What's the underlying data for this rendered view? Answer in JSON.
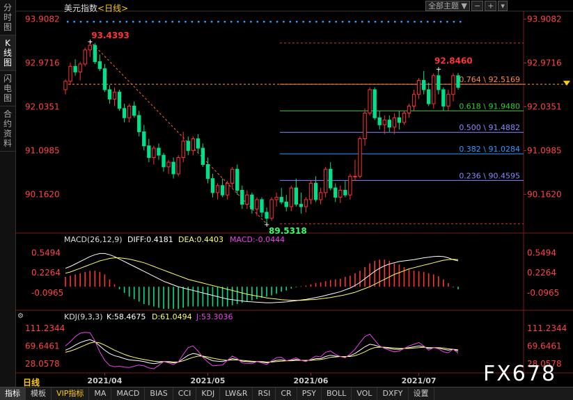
{
  "sidebar": [
    {
      "label": "分时图",
      "active": false
    },
    {
      "label": "K线图",
      "active": true
    },
    {
      "label": "闪电图",
      "active": false
    },
    {
      "label": "合约资料",
      "active": false
    }
  ],
  "header": {
    "symbol": "美元指数",
    "timeframe": "<日线>"
  },
  "top_controls": {
    "theme": "全部主题",
    "theme_arrow": "▼"
  },
  "period_label": "日线",
  "watermark": "FX678",
  "bottom_tabs": [
    {
      "label": "指标",
      "selected": true,
      "vip": false
    },
    {
      "label": "模板",
      "selected": false,
      "vip": false
    },
    {
      "label": "VIP指标",
      "selected": false,
      "vip": true
    },
    {
      "label": "MA",
      "selected": false,
      "vip": false
    },
    {
      "label": "MACD",
      "selected": false,
      "vip": false
    },
    {
      "label": "BIAS",
      "selected": false,
      "vip": false
    },
    {
      "label": "CCI",
      "selected": false,
      "vip": false
    },
    {
      "label": "KDJ",
      "selected": false,
      "vip": false
    },
    {
      "label": "LW&R",
      "selected": false,
      "vip": false
    },
    {
      "label": "RSI",
      "selected": false,
      "vip": false
    },
    {
      "label": "CR",
      "selected": false,
      "vip": false
    },
    {
      "label": "PSY",
      "selected": false,
      "vip": false
    },
    {
      "label": "BOLL",
      "selected": false,
      "vip": false
    },
    {
      "label": "VOL",
      "selected": false,
      "vip": false
    },
    {
      "label": "DXFY",
      "selected": false,
      "vip": false
    },
    {
      "label": "设置",
      "selected": false,
      "vip": false
    }
  ],
  "colors": {
    "up": "#ff3333",
    "down": "#00e08a",
    "fib": "#ff6633",
    "yellow": "#ffff66",
    "white": "#ffffff",
    "magenta": "#ee44ee",
    "blue": "#3399ff"
  },
  "chart_data": {
    "type": "candlestick",
    "main": {
      "ylim": [
        89.35,
        94.08
      ],
      "y_ticks": [
        "93.9082",
        "92.9716",
        "92.0351",
        "91.0985",
        "90.1620"
      ],
      "x_ticks": [
        "2021/04",
        "2021/05",
        "2021/06",
        "2021/07"
      ],
      "high_label": "93.4393",
      "low_label": "89.5318",
      "recent_high_label": "92.8460",
      "current_price": 92.5169,
      "fibonacci": [
        {
          "label": "0.764 \\ 92.5169",
          "value": 92.5169,
          "color": "#ff8844"
        },
        {
          "label": "0.618 \\ 91.9480",
          "value": 91.948,
          "color": "#33cc33"
        },
        {
          "label": "0.500 \\ 91.4882",
          "value": 91.4882,
          "color": "#8888ff"
        },
        {
          "label": "0.382 \\ 91.0284",
          "value": 91.0284,
          "color": "#3399ff"
        },
        {
          "label": "0.236 \\ 90.4595",
          "value": 90.4595,
          "color": "#8888ff"
        }
      ],
      "fib_top": 93.397,
      "fib_bottom": 89.5318,
      "candles": [
        [
          92.4,
          92.62,
          92.3,
          92.58
        ],
        [
          92.58,
          92.98,
          92.5,
          92.9
        ],
        [
          92.9,
          93.05,
          92.7,
          92.78
        ],
        [
          92.78,
          93.0,
          92.6,
          92.95
        ],
        [
          92.95,
          93.3,
          92.9,
          93.25
        ],
        [
          93.25,
          93.44,
          93.1,
          93.35
        ],
        [
          93.35,
          93.4,
          92.95,
          93.0
        ],
        [
          93.0,
          93.15,
          92.8,
          92.85
        ],
        [
          92.85,
          92.95,
          92.35,
          92.4
        ],
        [
          92.4,
          92.5,
          92.1,
          92.2
        ],
        [
          92.2,
          92.45,
          92.05,
          92.35
        ],
        [
          92.35,
          92.4,
          91.95,
          92.0
        ],
        [
          92.0,
          92.1,
          91.7,
          91.8
        ],
        [
          91.8,
          92.1,
          91.7,
          92.05
        ],
        [
          92.05,
          92.15,
          91.8,
          91.85
        ],
        [
          91.85,
          91.95,
          91.4,
          91.5
        ],
        [
          91.5,
          91.65,
          91.1,
          91.2
        ],
        [
          91.2,
          91.35,
          90.85,
          90.95
        ],
        [
          90.95,
          91.2,
          90.8,
          91.15
        ],
        [
          91.15,
          91.25,
          90.9,
          91.0
        ],
        [
          91.0,
          91.05,
          90.65,
          90.75
        ],
        [
          90.75,
          90.9,
          90.6,
          90.85
        ],
        [
          90.85,
          90.95,
          90.5,
          90.6
        ],
        [
          90.6,
          91.0,
          90.55,
          90.95
        ],
        [
          90.95,
          91.5,
          90.85,
          91.3
        ],
        [
          91.3,
          91.4,
          91.0,
          91.1
        ],
        [
          91.1,
          91.4,
          91.0,
          91.35
        ],
        [
          91.35,
          91.45,
          91.05,
          91.15
        ],
        [
          91.15,
          91.25,
          90.75,
          90.8
        ],
        [
          90.8,
          90.95,
          90.4,
          90.5
        ],
        [
          90.5,
          90.6,
          90.1,
          90.2
        ],
        [
          90.2,
          90.4,
          90.05,
          90.35
        ],
        [
          90.35,
          90.5,
          90.1,
          90.15
        ],
        [
          90.15,
          90.45,
          90.05,
          90.4
        ],
        [
          90.4,
          90.75,
          90.3,
          90.7
        ],
        [
          90.7,
          90.8,
          90.15,
          90.25
        ],
        [
          90.25,
          90.35,
          89.85,
          89.95
        ],
        [
          89.95,
          90.25,
          89.85,
          90.15
        ],
        [
          90.15,
          90.2,
          89.75,
          89.85
        ],
        [
          89.85,
          90.1,
          89.7,
          90.05
        ],
        [
          90.05,
          90.1,
          89.68,
          89.78
        ],
        [
          89.78,
          89.88,
          89.53,
          89.65
        ],
        [
          89.65,
          90.1,
          89.6,
          90.05
        ],
        [
          90.05,
          90.2,
          89.9,
          90.1
        ],
        [
          90.1,
          90.3,
          89.95,
          90.0
        ],
        [
          90.0,
          90.15,
          89.8,
          89.9
        ],
        [
          89.9,
          90.35,
          89.8,
          90.3
        ],
        [
          90.3,
          90.5,
          89.9,
          89.95
        ],
        [
          89.95,
          90.2,
          89.75,
          89.9
        ],
        [
          89.9,
          90.1,
          89.78,
          90.05
        ],
        [
          90.05,
          90.45,
          89.95,
          90.4
        ],
        [
          90.4,
          90.55,
          90.0,
          90.05
        ],
        [
          90.05,
          90.3,
          89.95,
          90.2
        ],
        [
          90.2,
          90.75,
          90.1,
          90.7
        ],
        [
          90.7,
          90.85,
          90.25,
          90.3
        ],
        [
          90.3,
          90.4,
          90.0,
          90.1
        ],
        [
          90.1,
          90.35,
          89.98,
          90.25
        ],
        [
          90.25,
          90.45,
          90.1,
          90.15
        ],
        [
          90.15,
          90.6,
          90.05,
          90.55
        ],
        [
          90.55,
          90.9,
          90.45,
          90.55
        ],
        [
          90.55,
          91.4,
          90.5,
          91.35
        ],
        [
          91.35,
          92.0,
          91.2,
          91.9
        ],
        [
          91.9,
          92.45,
          91.85,
          92.4
        ],
        [
          92.4,
          92.45,
          91.75,
          91.8
        ],
        [
          91.8,
          91.95,
          91.55,
          91.65
        ],
        [
          91.65,
          91.85,
          91.45,
          91.75
        ],
        [
          91.75,
          91.85,
          91.5,
          91.6
        ],
        [
          91.6,
          91.9,
          91.45,
          91.8
        ],
        [
          91.8,
          91.95,
          91.55,
          91.7
        ],
        [
          91.7,
          91.95,
          91.65,
          91.9
        ],
        [
          91.9,
          92.1,
          91.8,
          92.05
        ],
        [
          92.05,
          92.4,
          91.95,
          92.3
        ],
        [
          92.3,
          92.65,
          92.2,
          92.6
        ],
        [
          92.6,
          92.8,
          92.3,
          92.4
        ],
        [
          92.4,
          92.55,
          92.05,
          92.1
        ],
        [
          92.1,
          92.75,
          92.0,
          92.7
        ],
        [
          92.7,
          92.85,
          92.3,
          92.4
        ],
        [
          92.4,
          92.45,
          91.95,
          92.05
        ],
        [
          92.05,
          92.4,
          91.95,
          92.3
        ],
        [
          92.3,
          92.75,
          92.15,
          92.7
        ],
        [
          92.7,
          92.76,
          92.4,
          92.45
        ]
      ]
    },
    "macd": {
      "label": "MACD(26,12,9)",
      "diff_label": "DIFF:0.4181",
      "dea_label": "DEA:0.4403",
      "macd_label": "MACD:-0.0444",
      "ylim": [
        -0.37,
        0.68
      ],
      "y_ticks": [
        "0.5494",
        "0.2264",
        "-0.0965"
      ],
      "diff": [
        0.3,
        0.33,
        0.37,
        0.41,
        0.45,
        0.49,
        0.52,
        0.54,
        0.54,
        0.52,
        0.49,
        0.45,
        0.41,
        0.37,
        0.33,
        0.29,
        0.25,
        0.21,
        0.17,
        0.13,
        0.09,
        0.06,
        0.03,
        0.0,
        -0.02,
        -0.04,
        -0.06,
        -0.08,
        -0.1,
        -0.12,
        -0.14,
        -0.16,
        -0.18,
        -0.2,
        -0.21,
        -0.22,
        -0.23,
        -0.24,
        -0.245,
        -0.25,
        -0.255,
        -0.26,
        -0.26,
        -0.255,
        -0.25,
        -0.245,
        -0.235,
        -0.225,
        -0.215,
        -0.205,
        -0.19,
        -0.175,
        -0.16,
        -0.14,
        -0.12,
        -0.1,
        -0.08,
        -0.05,
        -0.02,
        0.02,
        0.07,
        0.13,
        0.19,
        0.25,
        0.3,
        0.34,
        0.37,
        0.39,
        0.41,
        0.42,
        0.43,
        0.44,
        0.455,
        0.47,
        0.48,
        0.49,
        0.495,
        0.49,
        0.47,
        0.44,
        0.42
      ],
      "dea": [
        0.22,
        0.24,
        0.27,
        0.3,
        0.33,
        0.36,
        0.39,
        0.42,
        0.44,
        0.46,
        0.47,
        0.47,
        0.46,
        0.45,
        0.43,
        0.41,
        0.39,
        0.36,
        0.33,
        0.3,
        0.27,
        0.24,
        0.21,
        0.18,
        0.15,
        0.12,
        0.1,
        0.08,
        0.06,
        0.04,
        0.02,
        0.0,
        -0.02,
        -0.04,
        -0.06,
        -0.08,
        -0.1,
        -0.12,
        -0.135,
        -0.15,
        -0.165,
        -0.18,
        -0.19,
        -0.2,
        -0.21,
        -0.215,
        -0.22,
        -0.22,
        -0.22,
        -0.215,
        -0.21,
        -0.205,
        -0.195,
        -0.185,
        -0.175,
        -0.16,
        -0.145,
        -0.13,
        -0.11,
        -0.09,
        -0.06,
        -0.03,
        0.0,
        0.04,
        0.08,
        0.12,
        0.16,
        0.2,
        0.23,
        0.26,
        0.29,
        0.31,
        0.33,
        0.35,
        0.37,
        0.39,
        0.41,
        0.43,
        0.44,
        0.445,
        0.44
      ]
    },
    "kdj": {
      "label": "KDJ(9,3,3)",
      "k_label": "K:58.4675",
      "d_label": "D:61.0494",
      "j_label": "J:53.3036",
      "ylim": [
        8,
        128
      ],
      "y_ticks": [
        "111.2344",
        "69.6461",
        "28.0578"
      ],
      "k": [
        60,
        65,
        72,
        78,
        82,
        85,
        80,
        70,
        60,
        52,
        47,
        44,
        40,
        37,
        36,
        35,
        33,
        30,
        28,
        30,
        33,
        32,
        30,
        32,
        40,
        48,
        52,
        50,
        45,
        40,
        35,
        34,
        33,
        36,
        40,
        38,
        34,
        33,
        32,
        33,
        32,
        30,
        33,
        36,
        37,
        35,
        36,
        38,
        36,
        35,
        37,
        40,
        40,
        45,
        48,
        46,
        45,
        44,
        47,
        52,
        60,
        68,
        74,
        72,
        68,
        66,
        64,
        62,
        62,
        64,
        66,
        68,
        70,
        68,
        64,
        66,
        65,
        62,
        60,
        62,
        58
      ],
      "d": [
        55,
        58,
        62,
        67,
        72,
        77,
        79,
        77,
        72,
        66,
        60,
        55,
        50,
        46,
        43,
        40,
        38,
        36,
        34,
        33,
        33,
        33,
        32,
        32,
        35,
        39,
        43,
        46,
        46,
        44,
        41,
        39,
        37,
        36,
        37,
        37,
        36,
        35,
        34,
        33,
        33,
        32,
        32,
        33,
        34,
        35,
        35,
        36,
        36,
        36,
        36,
        37,
        38,
        40,
        43,
        44,
        45,
        45,
        45,
        47,
        51,
        56,
        62,
        66,
        67,
        67,
        66,
        65,
        64,
        64,
        64,
        65,
        66,
        67,
        66,
        66,
        66,
        65,
        63,
        62,
        61
      ],
      "j": [
        70,
        80,
        92,
        100,
        102,
        101,
        82,
        56,
        36,
        24,
        21,
        22,
        20,
        19,
        22,
        25,
        23,
        18,
        16,
        24,
        33,
        30,
        26,
        32,
        50,
        66,
        70,
        58,
        43,
        32,
        23,
        24,
        25,
        36,
        46,
        40,
        30,
        29,
        28,
        33,
        30,
        26,
        35,
        42,
        43,
        35,
        38,
        42,
        36,
        33,
        39,
        46,
        44,
        55,
        58,
        50,
        45,
        42,
        51,
        62,
        78,
        92,
        98,
        84,
        70,
        64,
        60,
        56,
        58,
        64,
        70,
        74,
        78,
        70,
        60,
        66,
        63,
        56,
        54,
        62,
        53
      ]
    }
  }
}
